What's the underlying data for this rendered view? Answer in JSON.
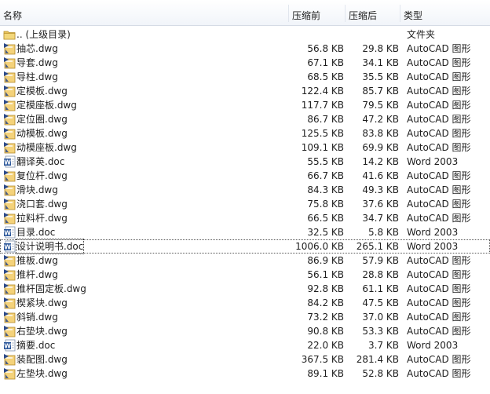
{
  "columns": {
    "name": "名称",
    "original_size": "压缩前",
    "compressed_size": "压缩后",
    "type": "类型"
  },
  "colors": {
    "folder": "#e8c25a",
    "word_blue": "#2b579a"
  },
  "files": [
    {
      "name": ".. (上级目录)",
      "original": "",
      "compressed": "",
      "type": "文件夹",
      "icon": "folder-icon"
    },
    {
      "name": "抽芯.dwg",
      "original": "56.8 KB",
      "compressed": "29.8 KB",
      "type": "AutoCAD 图形",
      "icon": "dwg-icon"
    },
    {
      "name": "导套.dwg",
      "original": "67.1 KB",
      "compressed": "34.1 KB",
      "type": "AutoCAD 图形",
      "icon": "dwg-icon"
    },
    {
      "name": "导柱.dwg",
      "original": "68.5 KB",
      "compressed": "35.5 KB",
      "type": "AutoCAD 图形",
      "icon": "dwg-icon"
    },
    {
      "name": "定模板.dwg",
      "original": "122.4 KB",
      "compressed": "85.7 KB",
      "type": "AutoCAD 图形",
      "icon": "dwg-icon"
    },
    {
      "name": "定模座板.dwg",
      "original": "117.7 KB",
      "compressed": "79.5 KB",
      "type": "AutoCAD 图形",
      "icon": "dwg-icon"
    },
    {
      "name": "定位圈.dwg",
      "original": "86.7 KB",
      "compressed": "47.2 KB",
      "type": "AutoCAD 图形",
      "icon": "dwg-icon"
    },
    {
      "name": "动模板.dwg",
      "original": "125.5 KB",
      "compressed": "83.8 KB",
      "type": "AutoCAD 图形",
      "icon": "dwg-icon"
    },
    {
      "name": "动模座板.dwg",
      "original": "109.1 KB",
      "compressed": "69.9 KB",
      "type": "AutoCAD 图形",
      "icon": "dwg-icon"
    },
    {
      "name": "翻译英.doc",
      "original": "55.5 KB",
      "compressed": "14.2 KB",
      "type": "Word 2003",
      "icon": "word-doc-icon"
    },
    {
      "name": "复位杆.dwg",
      "original": "66.7 KB",
      "compressed": "41.6 KB",
      "type": "AutoCAD 图形",
      "icon": "dwg-icon"
    },
    {
      "name": "滑块.dwg",
      "original": "84.3 KB",
      "compressed": "49.3 KB",
      "type": "AutoCAD 图形",
      "icon": "dwg-icon"
    },
    {
      "name": "浇口套.dwg",
      "original": "75.8 KB",
      "compressed": "37.6 KB",
      "type": "AutoCAD 图形",
      "icon": "dwg-icon"
    },
    {
      "name": "拉料杆.dwg",
      "original": "66.5 KB",
      "compressed": "34.7 KB",
      "type": "AutoCAD 图形",
      "icon": "dwg-icon"
    },
    {
      "name": "目录.doc",
      "original": "32.5 KB",
      "compressed": "5.8 KB",
      "type": "Word 2003",
      "icon": "word-doc-icon"
    },
    {
      "name": "设计说明书.doc",
      "original": "1006.0 KB",
      "compressed": "265.1 KB",
      "type": "Word 2003",
      "icon": "word-doc-icon",
      "focused": true
    },
    {
      "name": "推板.dwg",
      "original": "86.9 KB",
      "compressed": "57.9 KB",
      "type": "AutoCAD 图形",
      "icon": "dwg-icon"
    },
    {
      "name": "推杆.dwg",
      "original": "56.1 KB",
      "compressed": "28.8 KB",
      "type": "AutoCAD 图形",
      "icon": "dwg-icon"
    },
    {
      "name": "推杆固定板.dwg",
      "original": "92.8 KB",
      "compressed": "61.1 KB",
      "type": "AutoCAD 图形",
      "icon": "dwg-icon"
    },
    {
      "name": "楔紧块.dwg",
      "original": "84.2 KB",
      "compressed": "47.5 KB",
      "type": "AutoCAD 图形",
      "icon": "dwg-icon"
    },
    {
      "name": "斜销.dwg",
      "original": "73.2 KB",
      "compressed": "37.0 KB",
      "type": "AutoCAD 图形",
      "icon": "dwg-icon"
    },
    {
      "name": "右垫块.dwg",
      "original": "90.8 KB",
      "compressed": "53.3 KB",
      "type": "AutoCAD 图形",
      "icon": "dwg-icon"
    },
    {
      "name": "摘要.doc",
      "original": "22.0 KB",
      "compressed": "3.7 KB",
      "type": "Word 2003",
      "icon": "word-doc-icon"
    },
    {
      "name": "装配图.dwg",
      "original": "367.5 KB",
      "compressed": "281.4 KB",
      "type": "AutoCAD 图形",
      "icon": "dwg-icon"
    },
    {
      "name": "左垫块.dwg",
      "original": "89.1 KB",
      "compressed": "52.8 KB",
      "type": "AutoCAD 图形",
      "icon": "dwg-icon"
    }
  ]
}
